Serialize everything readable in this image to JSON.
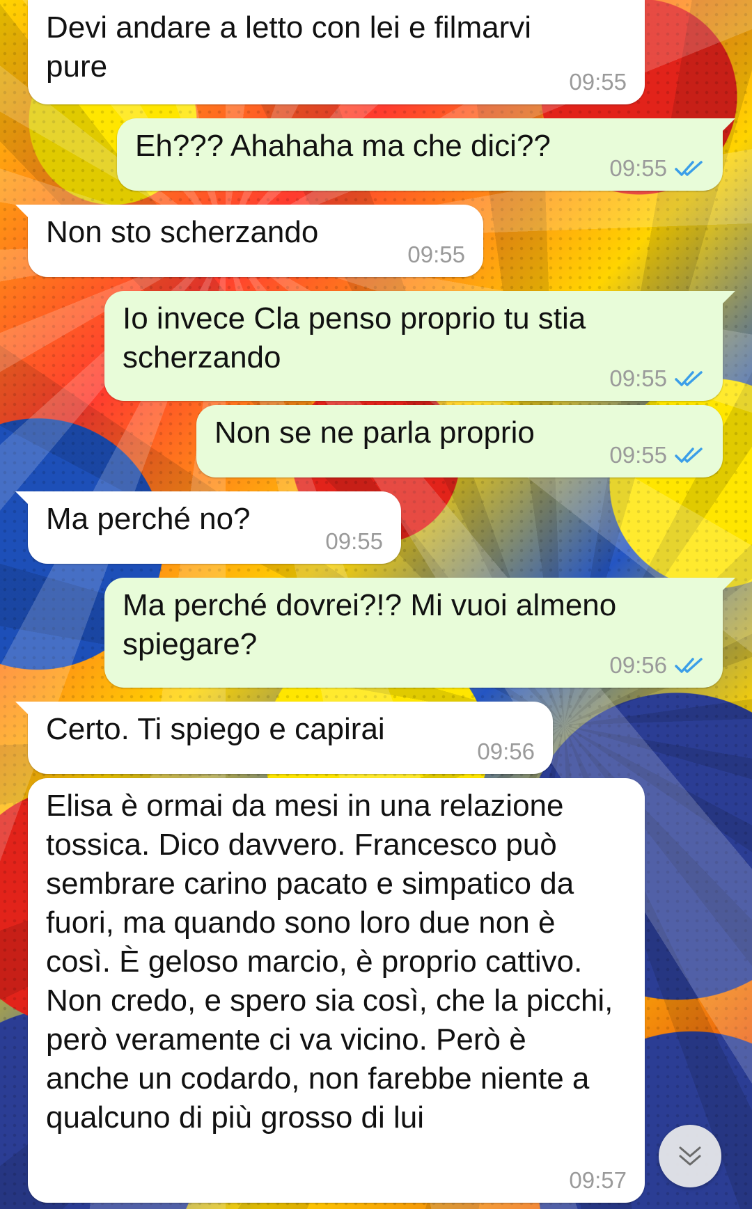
{
  "colors": {
    "incoming_bubble": "#ffffff",
    "outgoing_bubble": "#e8fcd9",
    "timestamp": "#9a9a9a",
    "read_ticks": "#3b9ee8"
  },
  "messages": [
    {
      "direction": "in",
      "text": "Devi andare a letto con lei e filmarvi pure",
      "time": "09:55"
    },
    {
      "direction": "out",
      "text": "Eh??? Ahahaha ma che dici??",
      "time": "09:55",
      "status": "read"
    },
    {
      "direction": "in",
      "text": "Non sto scherzando",
      "time": "09:55"
    },
    {
      "direction": "out",
      "text": "Io invece Cla penso proprio tu stia scherzando",
      "time": "09:55",
      "status": "read"
    },
    {
      "direction": "out",
      "text": "Non se ne parla proprio",
      "time": "09:55",
      "status": "read"
    },
    {
      "direction": "in",
      "text": "Ma perché no?",
      "time": "09:55"
    },
    {
      "direction": "out",
      "text": "Ma perché dovrei?!? Mi vuoi almeno spiegare?",
      "time": "09:56",
      "status": "read"
    },
    {
      "direction": "in",
      "text": "Certo. Ti spiego e capirai",
      "time": "09:56"
    },
    {
      "direction": "in",
      "text": "Elisa è ormai da mesi in una relazione tossica. Dico davvero. Francesco può sembrare carino pacato e simpatico da fuori, ma quando sono loro due non è così. È geloso marcio, è proprio cattivo. Non credo, e spero sia così, che la picchi, però veramente ci va vicino. Però è anche un codardo, non farebbe niente a qualcuno di più grosso di lui",
      "time": "09:57"
    }
  ],
  "scroll_button": {
    "icon": "double-chevron-down-icon"
  }
}
